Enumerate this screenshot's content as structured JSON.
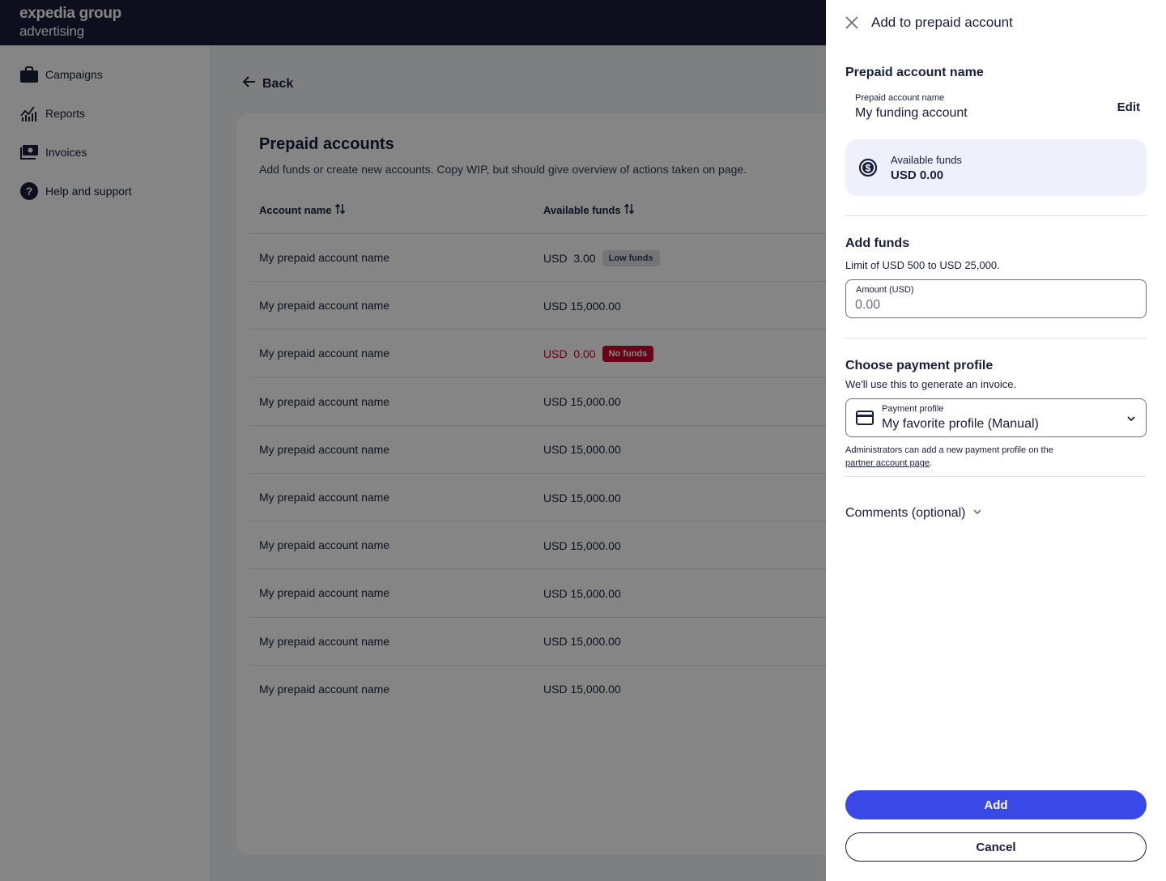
{
  "brand": {
    "line1": "expedia group",
    "line2": "advertising"
  },
  "sidebar": {
    "items": [
      {
        "label": "Campaigns"
      },
      {
        "label": "Reports"
      },
      {
        "label": "Invoices"
      },
      {
        "label": "Help and support"
      }
    ]
  },
  "main": {
    "back_label": "Back",
    "title": "Prepaid accounts",
    "subtitle": "Add funds or create new accounts. Copy WIP, but should give overview of actions taken on page.",
    "columns": [
      "Account name",
      "Available funds"
    ],
    "rows": [
      {
        "name": "My prepaid account name",
        "funds": "USD  3.00",
        "badge": "Low funds",
        "status": "low"
      },
      {
        "name": "My prepaid account name",
        "funds": "USD 15,000.00",
        "badge": "",
        "status": "ok"
      },
      {
        "name": "My prepaid account name",
        "funds": "USD  0.00",
        "badge": "No funds",
        "status": "none"
      },
      {
        "name": "My prepaid account name",
        "funds": "USD 15,000.00",
        "badge": "",
        "status": "ok"
      },
      {
        "name": "My prepaid account name",
        "funds": "USD 15,000.00",
        "badge": "",
        "status": "ok"
      },
      {
        "name": "My prepaid account name",
        "funds": "USD 15,000.00",
        "badge": "",
        "status": "ok"
      },
      {
        "name": "My prepaid account name",
        "funds": "USD 15,000.00",
        "badge": "",
        "status": "ok"
      },
      {
        "name": "My prepaid account name",
        "funds": "USD 15,000.00",
        "badge": "",
        "status": "ok"
      },
      {
        "name": "My prepaid account name",
        "funds": "USD 15,000.00",
        "badge": "",
        "status": "ok"
      },
      {
        "name": "My prepaid account name",
        "funds": "USD 15,000.00",
        "badge": "",
        "status": "ok"
      }
    ]
  },
  "panel": {
    "title": "Add to prepaid account",
    "account_section": {
      "heading": "Prepaid account name",
      "label": "Prepaid account name",
      "value": "My funding account",
      "edit_label": "Edit"
    },
    "available": {
      "label": "Available funds",
      "value": "USD 0.00"
    },
    "add_funds": {
      "heading": "Add funds",
      "help": "Limit of USD 500 to USD 25,000.",
      "field_label": "Amount (USD)",
      "placeholder": "0.00"
    },
    "payment": {
      "heading": "Choose payment profile",
      "help": "We'll use this to generate an invoice.",
      "field_label": "Payment profile",
      "value": "My favorite profile (Manual)",
      "note": "Administrators can add a new payment profile on the",
      "note_link": "partner account page",
      "note_end": "."
    },
    "comments_label": "Comments (optional)",
    "add_button": "Add",
    "cancel_button": "Cancel"
  },
  "colors": {
    "navy": "#191e3b",
    "primary": "#3b48e8",
    "danger": "#c9052c",
    "funds_bg": "#eef0fb"
  }
}
